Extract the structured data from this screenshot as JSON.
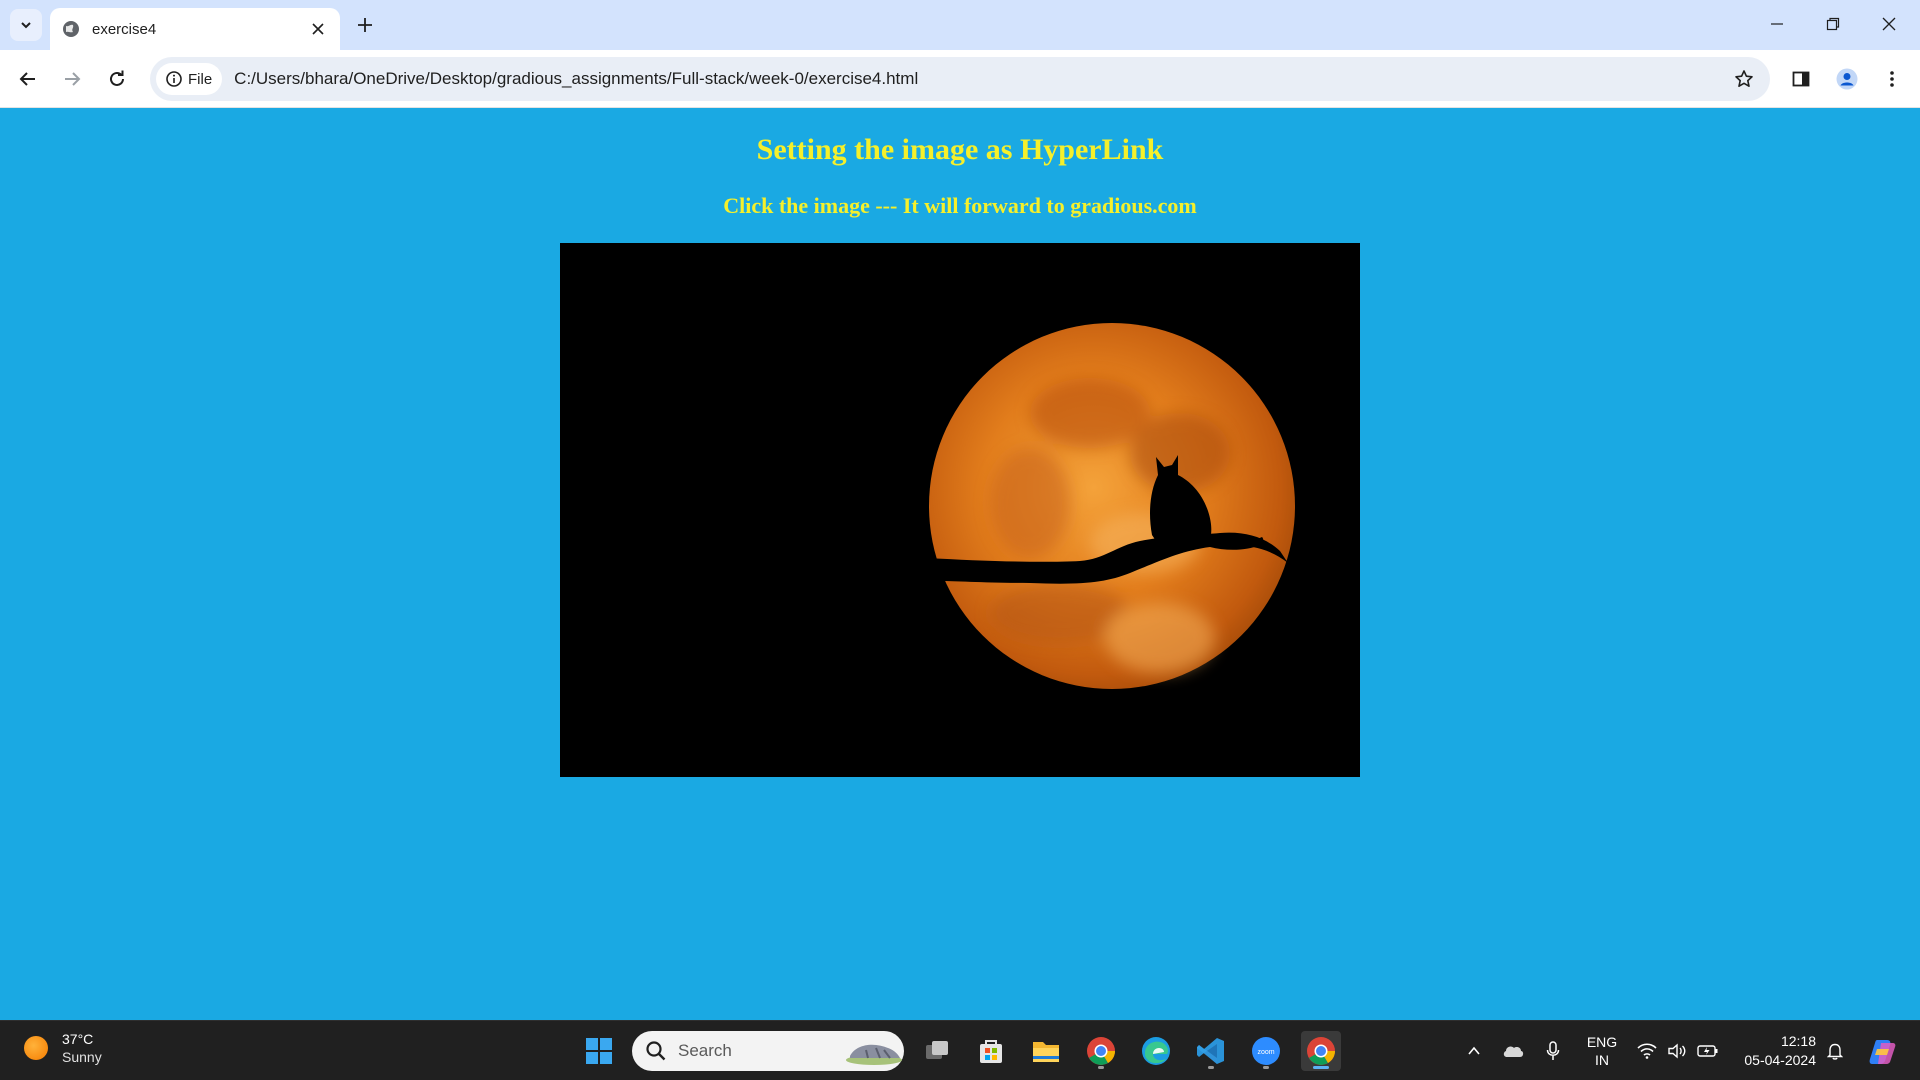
{
  "browser": {
    "tab_title": "exercise4",
    "address_chip": "File",
    "url": "C:/Users/bhara/OneDrive/Desktop/gradious_assignments/Full-stack/week-0/exercise4.html"
  },
  "page": {
    "heading": "Setting the image as HyperLink",
    "subheading": "Click the image --- It will forward to gradious.com",
    "background_color": "#1aa9e3",
    "text_color": "#f5f02b"
  },
  "taskbar": {
    "weather_temp": "37°C",
    "weather_desc": "Sunny",
    "search_label": "Search",
    "lang_primary": "ENG",
    "lang_secondary": "IN",
    "time": "12:18",
    "date": "05-04-2024",
    "pinned_apps": [
      "windows-start",
      "task-view",
      "microsoft-store",
      "file-explorer",
      "chrome",
      "edge",
      "vscode",
      "zoom",
      "chrome-active"
    ]
  }
}
